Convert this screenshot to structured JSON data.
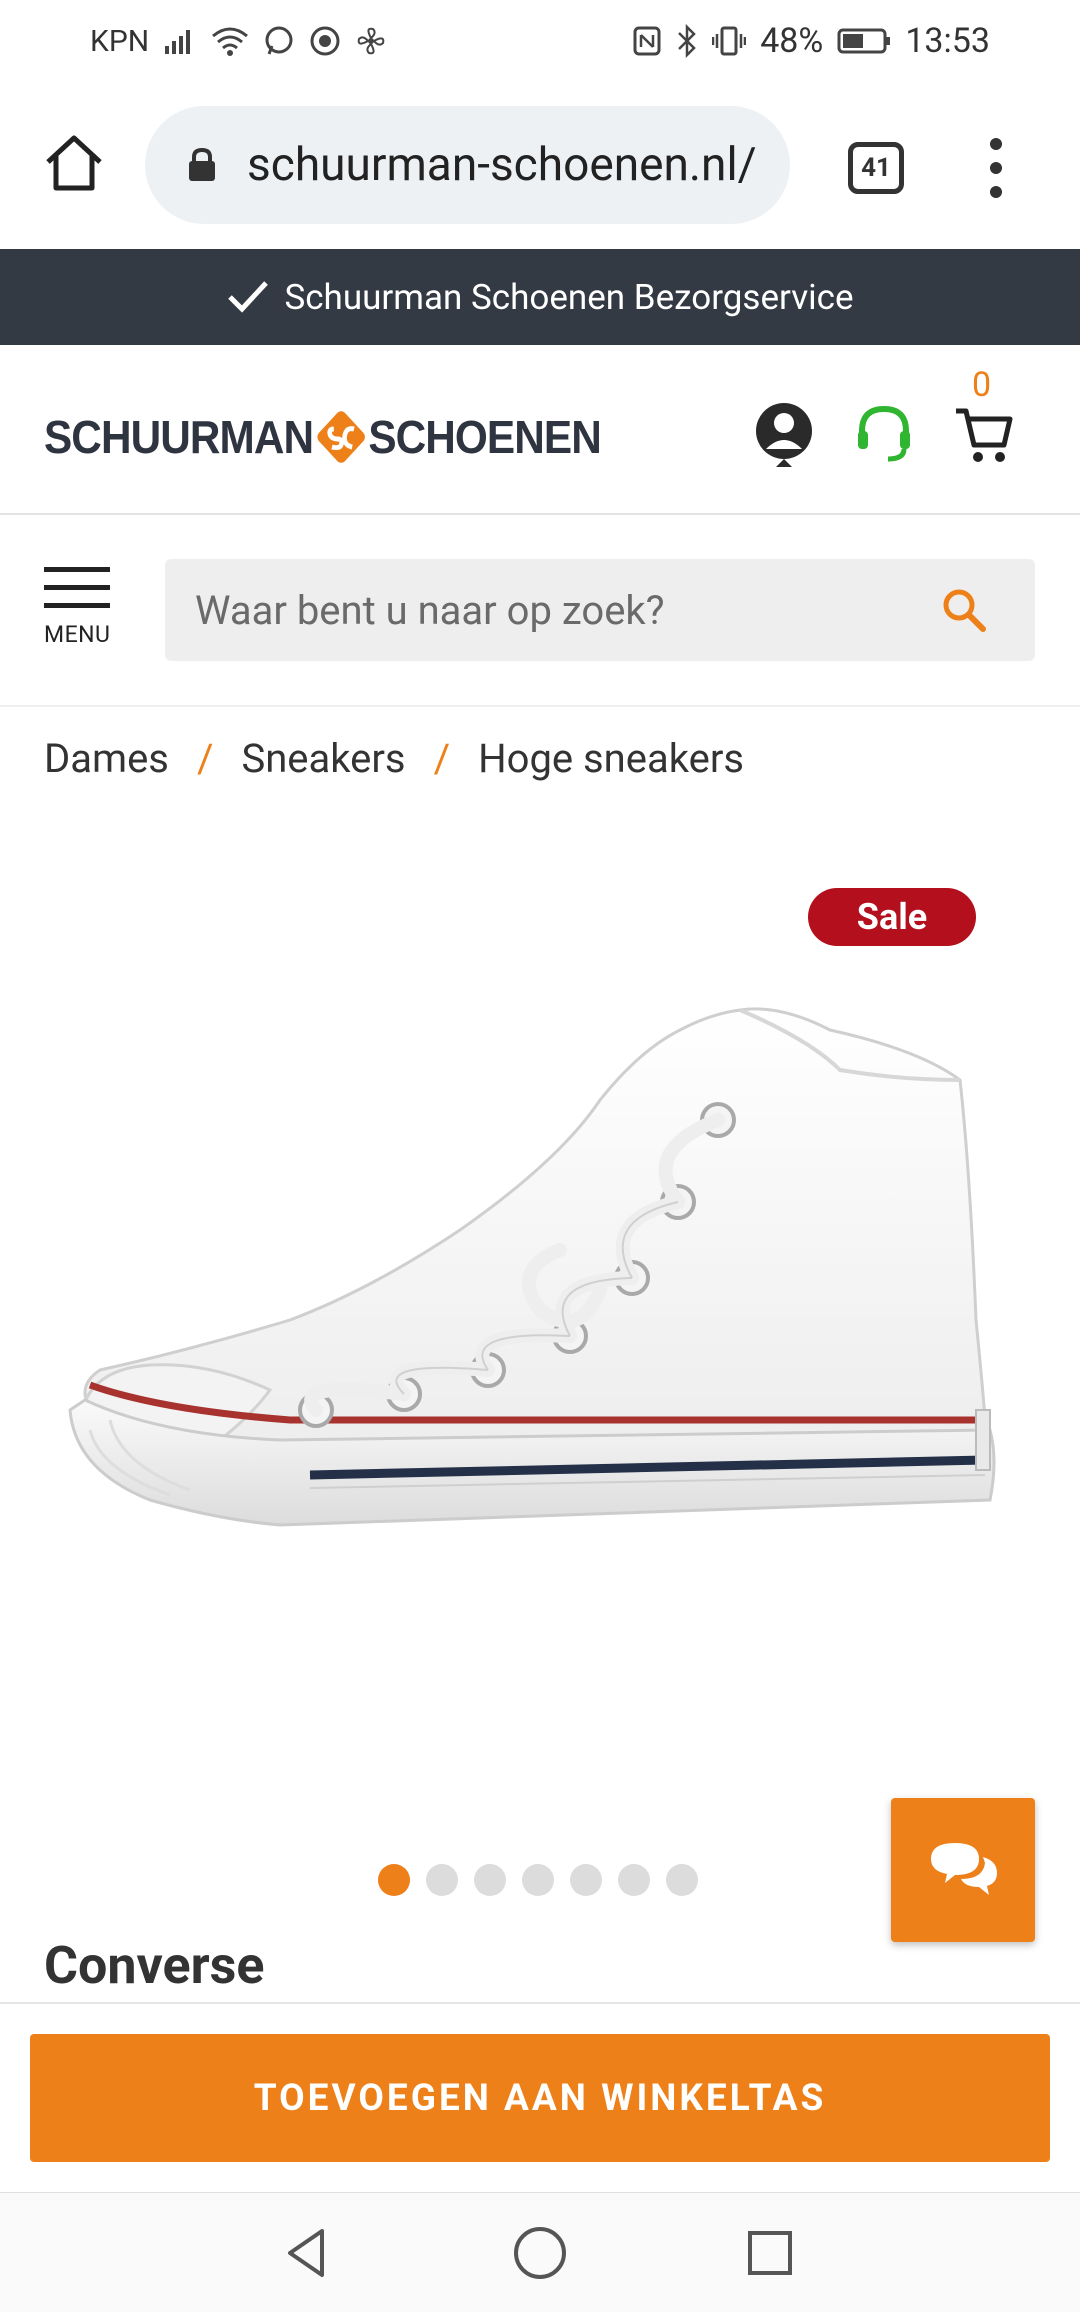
{
  "status_bar": {
    "carrier": "KPN",
    "battery": "48%",
    "time": "13:53"
  },
  "browser": {
    "url": "schuurman-schoenen.nl/",
    "tab_count": "41"
  },
  "banner": {
    "text": "Schuurman Schoenen Bezorgservice"
  },
  "header": {
    "logo_left": "SCHUURMAN",
    "logo_right": "SCHOENEN",
    "cart_count": "0"
  },
  "search": {
    "menu_label": "MENU",
    "placeholder": "Waar bent u naar op zoek?"
  },
  "breadcrumb": {
    "items": [
      "Dames",
      "Sneakers",
      "Hoge sneakers"
    ],
    "separator": "/"
  },
  "product": {
    "badge": "Sale",
    "brand": "Converse",
    "image_count": 7,
    "active_image": 1
  },
  "actions": {
    "add_to_cart": "TOEVOEGEN AAN WINKELTAS"
  },
  "colors": {
    "accent": "#ee8019",
    "banner_bg": "#343a44",
    "sale": "#b30f1c",
    "support_green": "#2fb52f"
  },
  "icons": [
    "home-icon",
    "lock-icon",
    "tabs-icon",
    "more-icon",
    "check-icon",
    "account-icon",
    "support-headset-icon",
    "cart-icon",
    "menu-icon",
    "search-icon",
    "chat-icon",
    "back-icon",
    "home-circle-icon",
    "recents-icon"
  ]
}
